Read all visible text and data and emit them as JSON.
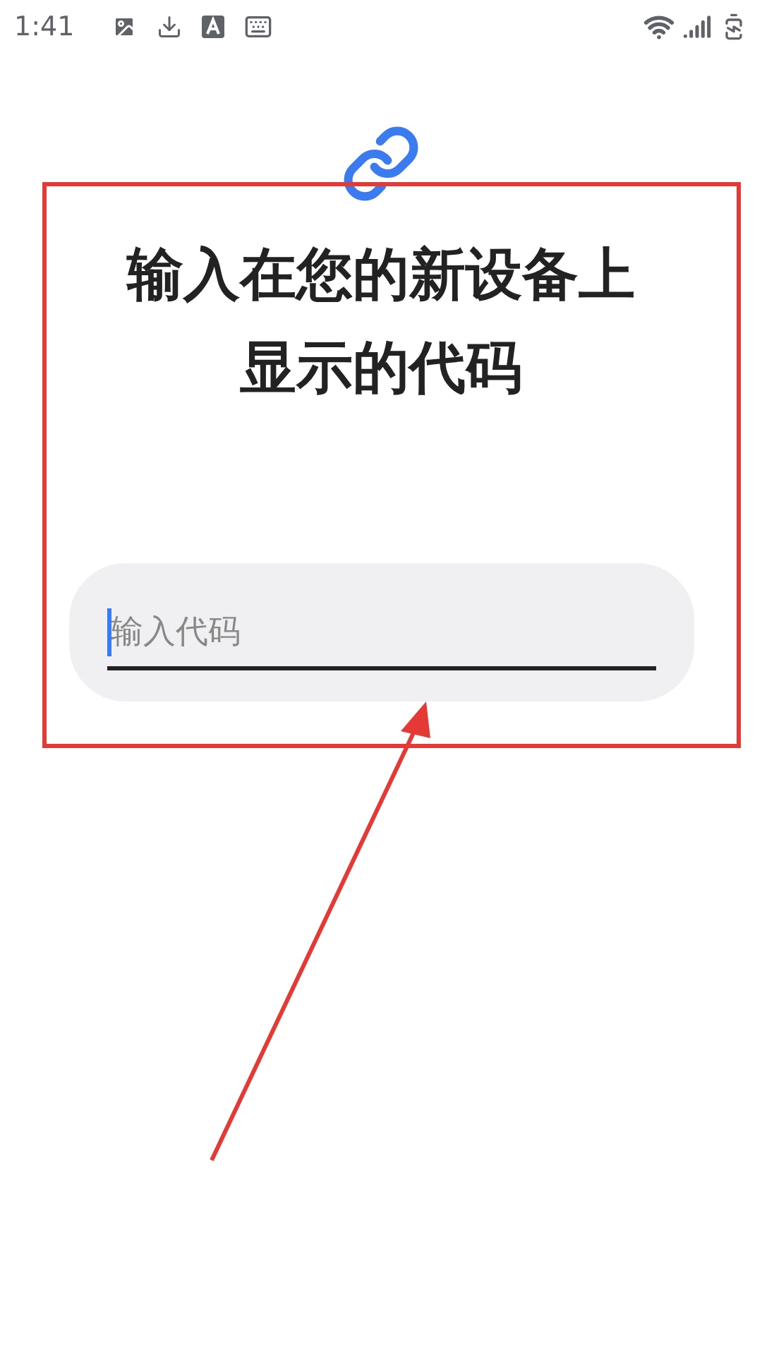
{
  "status_bar": {
    "time": "1:41"
  },
  "title": "输入在您的新设备上显示的代码",
  "code_field": {
    "placeholder": "输入代码"
  }
}
